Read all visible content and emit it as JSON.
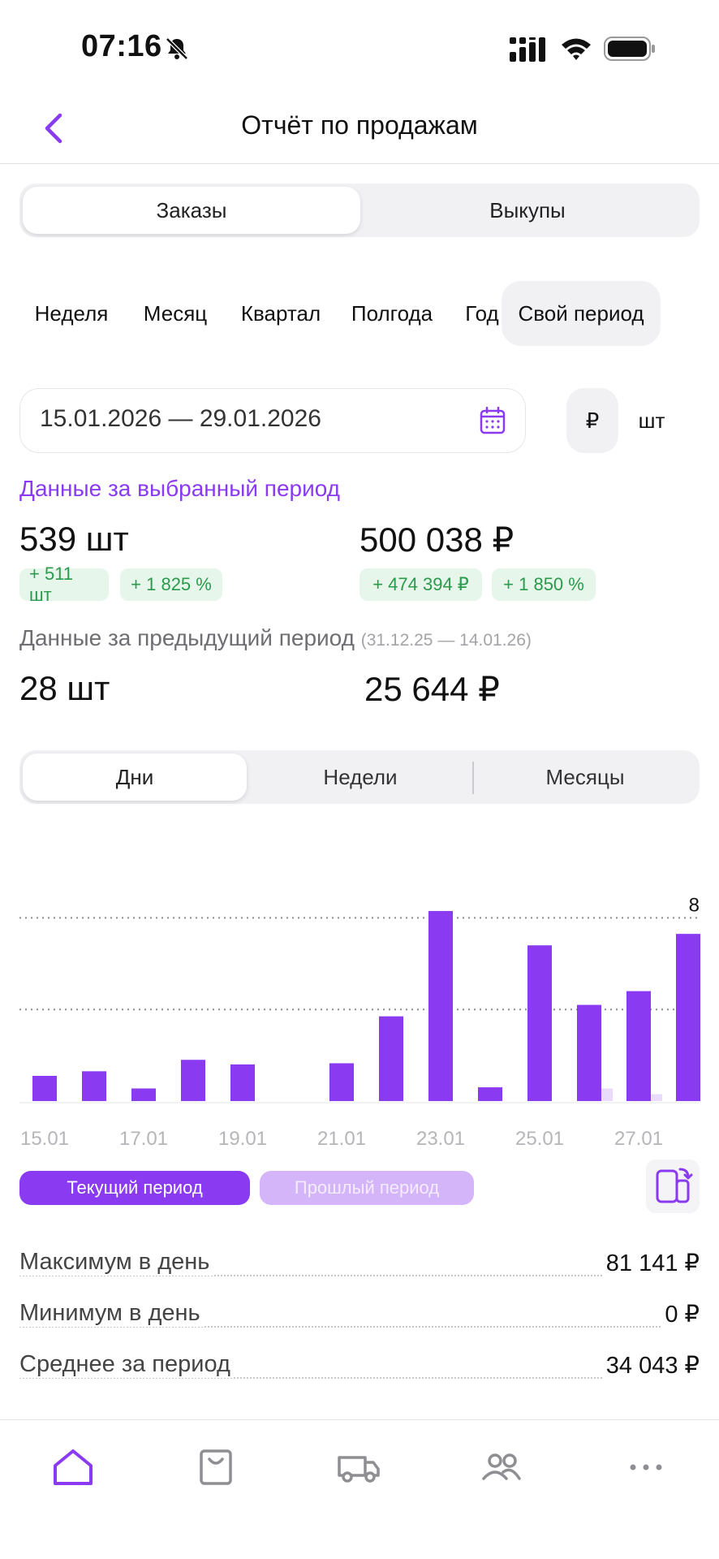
{
  "status_bar": {
    "time": "07:16"
  },
  "header": {
    "title": "Отчёт по продажам"
  },
  "report_tabs": [
    {
      "label": "Заказы",
      "active": true
    },
    {
      "label": "Выкупы",
      "active": false
    }
  ],
  "periods": [
    {
      "label": "Неделя",
      "active": false
    },
    {
      "label": "Месяц",
      "active": false
    },
    {
      "label": "Квартал",
      "active": false
    },
    {
      "label": "Полгода",
      "active": false
    },
    {
      "label": "Год",
      "active": false
    },
    {
      "label": "Свой период",
      "active": true
    }
  ],
  "date_range": "15.01.2026 — 29.01.2026",
  "units": {
    "rub": "₽",
    "pcs": "шт",
    "selected": "rub"
  },
  "current": {
    "title": "Данные за выбранный период",
    "quantity": "539 шт",
    "quantity_delta": "+ 511 шт",
    "quantity_delta_pct": "+ 1 825 %",
    "amount": "500 038 ₽",
    "amount_delta": "+ 474 394 ₽",
    "amount_delta_pct": "+ 1 850 %"
  },
  "previous": {
    "title": "Данные за предыдущий период",
    "range": "(31.12.25 — 14.01.26)",
    "quantity": "28 шт",
    "amount": "25 644 ₽"
  },
  "granularity": [
    {
      "label": "Дни",
      "active": true
    },
    {
      "label": "Недели",
      "active": false
    },
    {
      "label": "Месяцы",
      "active": false
    }
  ],
  "chart_data": {
    "type": "bar",
    "categories": [
      "15.01",
      "16.01",
      "17.01",
      "18.01",
      "19.01",
      "20.01",
      "21.01",
      "22.01",
      "23.01",
      "24.01",
      "25.01",
      "26.01",
      "27.01",
      "28.01"
    ],
    "tick_labels": [
      "15.01",
      "17.01",
      "19.01",
      "21.01",
      "23.01",
      "25.01",
      "27.01"
    ],
    "series": [
      {
        "name": "Текущий период",
        "color": "#8a3bf2",
        "values": [
          1.1,
          1.3,
          0.55,
          1.8,
          1.6,
          0,
          1.65,
          3.7,
          8.3,
          0.6,
          6.8,
          4.2,
          4.8,
          7.3
        ]
      },
      {
        "name": "Прошлый период",
        "color": "#e9dcfb",
        "values": [
          0,
          0,
          0,
          0,
          0,
          0,
          0,
          0,
          0,
          0,
          0,
          0.55,
          0.3,
          0
        ]
      }
    ],
    "y_ticks": [
      "8",
      "4"
    ],
    "ylim": [
      0,
      10
    ],
    "grid": "dotted"
  },
  "legend": {
    "current": "Текущий период",
    "previous": "Прошлый период"
  },
  "stats": [
    {
      "label": "Максимум в день",
      "value": "81 141 ₽"
    },
    {
      "label": "Минимум в день",
      "value": "0 ₽"
    },
    {
      "label": "Среднее за период",
      "value": "34 043 ₽"
    }
  ],
  "bottom_nav": [
    {
      "icon": "home-icon",
      "active": true
    },
    {
      "icon": "shopping-bag-icon",
      "active": false
    },
    {
      "icon": "truck-icon",
      "active": false
    },
    {
      "icon": "users-icon",
      "active": false
    },
    {
      "icon": "more-icon",
      "active": false
    }
  ],
  "colors": {
    "accent": "#8a3bf2",
    "positive": "#2b9a4c",
    "positive_bg": "#e6f6ea"
  }
}
